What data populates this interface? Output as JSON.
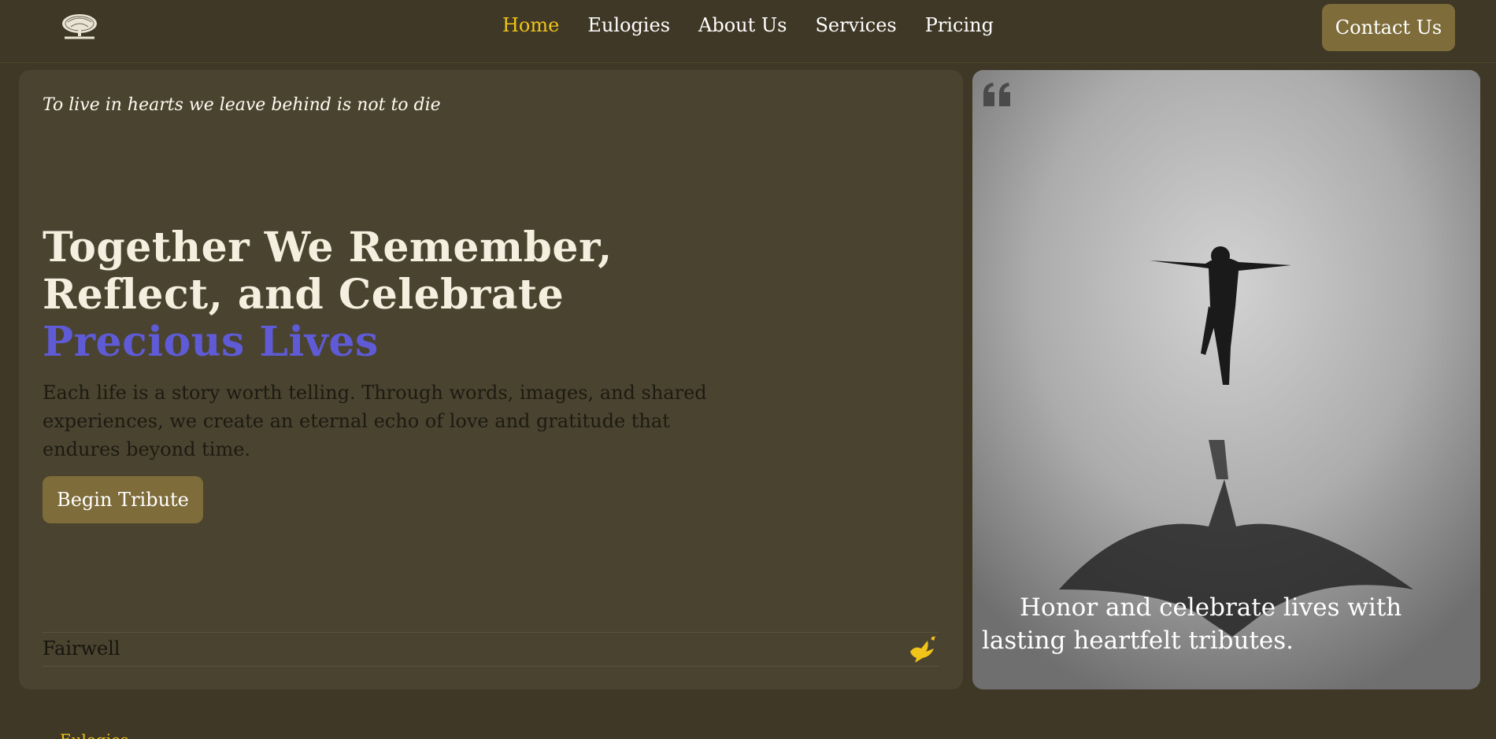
{
  "nav": {
    "logo_icon": "tree-logo-icon",
    "links": [
      "Home",
      "Eulogies",
      "About Us",
      "Services",
      "Pricing"
    ],
    "active_index": 0,
    "contact_label": "Contact Us"
  },
  "hero": {
    "quote": "To live in hearts we leave behind is not to die",
    "headline_line1": "Together We Remember,",
    "headline_line2": "Reflect, and Celebrate",
    "headline_accent": "Precious Lives",
    "description": "Each life is a story worth telling. Through words, images, and shared experiences, we create an eternal echo of love and gratitude that endures beyond time.",
    "cta_label": "Begin Tribute",
    "footer_label": "Fairwell",
    "footer_icon": "dove-icon"
  },
  "image_card": {
    "quote_icon": "quote-mark-icon",
    "caption": "Honor and celebrate lives with lasting heartfelt tributes."
  },
  "next_section": {
    "label": "Eulogies"
  },
  "colors": {
    "background": "#3f3826",
    "card": "#4a4330",
    "button": "#7e6c3a",
    "active_link": "#f0c419",
    "accent_text": "#5f5bd6"
  }
}
